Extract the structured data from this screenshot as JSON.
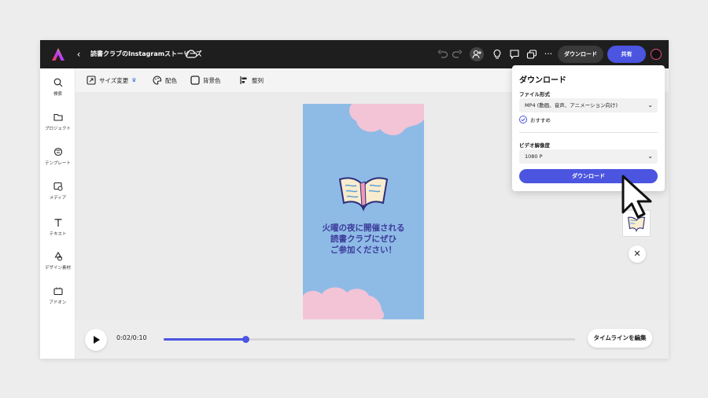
{
  "topbar": {
    "doc_title": "読書クラブのInstagramストーリーズ",
    "more": "···",
    "download_label": "ダウンロード",
    "share_label": "共有",
    "icons": [
      "adobe-express-logo",
      "back-icon",
      "cloud-icon",
      "undo-icon",
      "redo-icon",
      "invite-icon",
      "bulb-icon",
      "comment-icon",
      "copy-icon",
      "more-icon",
      "avatar"
    ]
  },
  "sidebar": {
    "items": [
      {
        "label": "検索",
        "icon": "search-icon"
      },
      {
        "label": "プロジェクト",
        "icon": "folder-icon"
      },
      {
        "label": "テンプレート",
        "icon": "template-icon"
      },
      {
        "label": "メディア",
        "icon": "media-icon"
      },
      {
        "label": "テキスト",
        "icon": "text-icon"
      },
      {
        "label": "デザイン素材",
        "icon": "shapes-icon"
      },
      {
        "label": "アドオン",
        "icon": "addon-icon"
      }
    ]
  },
  "toolbar": {
    "resize": "サイズ変更",
    "crown": "♛",
    "colors": "配色",
    "background": "背景色",
    "align": "整列"
  },
  "design": {
    "lines": [
      "火曜の夜に開催される",
      "読書クラブにぜひ",
      "ご参加ください！"
    ],
    "bg_color": "#8ebbe6",
    "cloud_color": "#f3c4d6",
    "text_color": "#3b3b9a"
  },
  "timeline": {
    "time": "0:02/0:10",
    "progress": 0.2,
    "edit_label": "タイムラインを編集"
  },
  "close_symbol": "✕",
  "download_panel": {
    "title": "ダウンロード",
    "file_format_label": "ファイル形式",
    "file_format_value": "MP4 (動画、音声、アニメーション向け)",
    "recommended": "おすすめ",
    "resolution_label": "ビデオ解像度",
    "resolution_value": "1080 P",
    "chevron": "⌄",
    "download_button": "ダウンロード"
  },
  "colors": {
    "accent": "#4b55e0",
    "topbar": "#1e1e1e"
  }
}
